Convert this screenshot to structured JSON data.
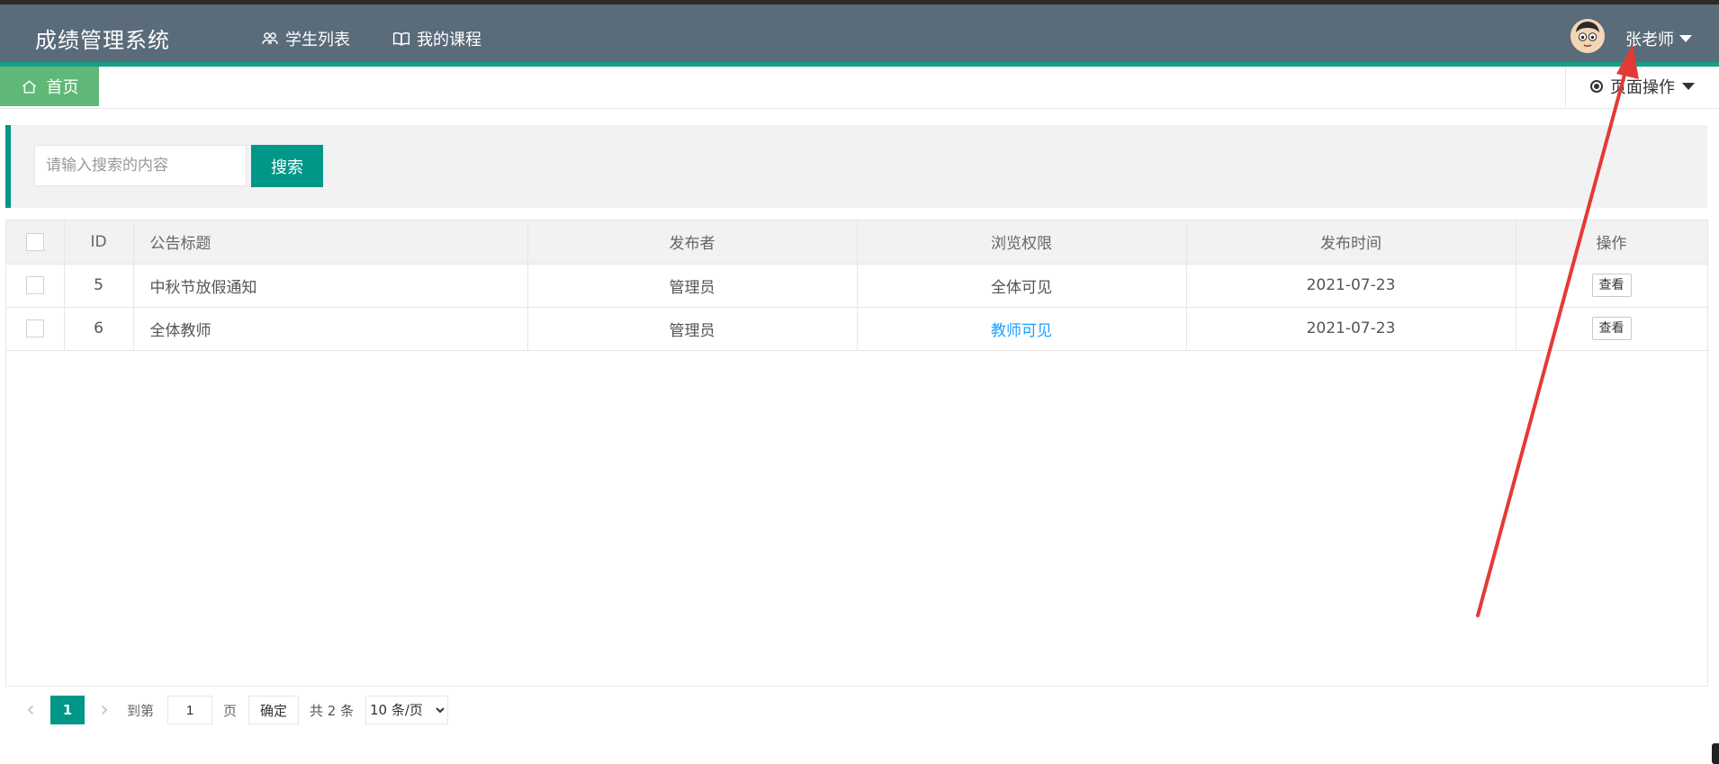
{
  "app": {
    "title": "成绩管理系统"
  },
  "nav": {
    "students": "学生列表",
    "courses": "我的课程"
  },
  "user": {
    "name": "张老师"
  },
  "tabs": {
    "home": "首页",
    "page_ops": "页面操作"
  },
  "search": {
    "placeholder": "请输入搜索的内容",
    "button": "搜索"
  },
  "table": {
    "headers": {
      "id": "ID",
      "title": "公告标题",
      "publisher": "发布者",
      "permission": "浏览权限",
      "time": "发布时间",
      "action": "操作"
    },
    "rows": [
      {
        "id": "5",
        "title": "中秋节放假通知",
        "publisher": "管理员",
        "permission": "全体可见",
        "time": "2021-07-23",
        "action": "查看"
      },
      {
        "id": "6",
        "title": "全体教师",
        "publisher": "管理员",
        "permission": "教师可见",
        "time": "2021-07-23",
        "action": "查看"
      }
    ]
  },
  "pagination": {
    "current_page": "1",
    "goto_label": "到第",
    "goto_value": "1",
    "page_label": "页",
    "confirm": "确定",
    "total": "共 2 条",
    "per_page": "10 条/页"
  },
  "colors": {
    "header": "#5a6b7a",
    "accent": "#009688",
    "home_tab": "#5fb878",
    "link_blue": "#1e9fff",
    "arrow": "#e53935"
  },
  "icons": {
    "students": "users-icon",
    "courses": "book-icon",
    "home": "home-icon",
    "page_ops": "radio-dot-icon",
    "user_menu": "caret-down-icon",
    "avatar": "avatar"
  }
}
